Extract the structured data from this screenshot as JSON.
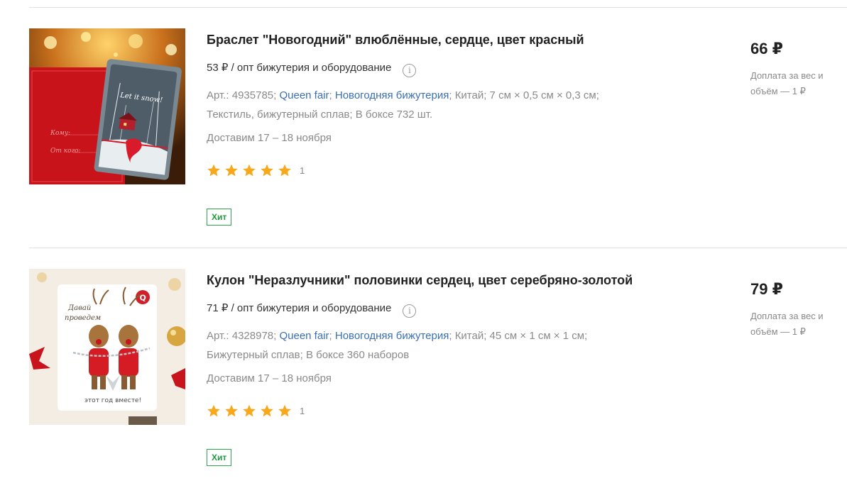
{
  "products": [
    {
      "title": "Браслет \"Новогодний\" влюблённые, сердце, цвет красный",
      "opt_price": "53 ₽ / опт бижутерия и оборудование",
      "art": "Арт.: 4935785;",
      "brand": "Queen fair",
      "category": "Новогодняя бижутерия",
      "specs_line1": "Китай; 7 см × 0,5 см × 0,3 см;",
      "specs_line2": "Текстиль, бижутерный сплав; В боксе 732 шт.",
      "delivery": "Доставим 17 – 18 ноября",
      "reviews": "1",
      "rating": 5,
      "badge": "Хит",
      "price": "66 ₽",
      "surcharge": "Доплата за вес и объём — 1 ₽",
      "image_text": "Let it snow!",
      "card_to": "Кому:",
      "card_from": "От кого:"
    },
    {
      "title": "Кулон \"Неразлучники\" половинки сердец, цвет серебряно-золотой",
      "opt_price": "71 ₽ / опт бижутерия и оборудование",
      "art": "Арт.: 4328978;",
      "brand": "Queen fair",
      "category": "Новогодняя бижутерия",
      "specs_line1": "Китай; 45 см × 1 см × 1 см;",
      "specs_line2": "Бижутерный сплав; В боксе 360 наборов",
      "delivery": "Доставим 17 – 18 ноября",
      "reviews": "1",
      "rating": 5,
      "badge": "Хит",
      "price": "79 ₽",
      "surcharge": "Доплата за вес и объём — 1 ₽",
      "image_text_1": "Давай",
      "image_text_2": "проведем",
      "image_text_3": "этот год вместе!"
    }
  ],
  "info_icon_glyph": "i",
  "colors": {
    "link": "#3a6fb5",
    "star": "#f7a81b",
    "badge": "#2aa84a",
    "muted": "#8a8a8a"
  }
}
